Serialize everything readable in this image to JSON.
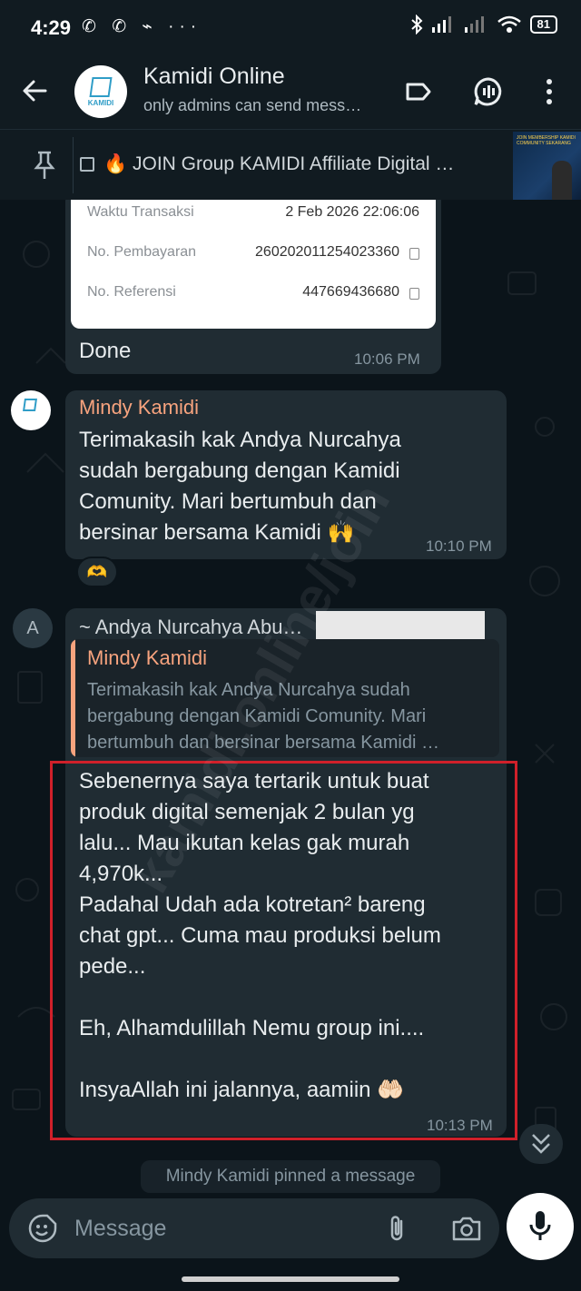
{
  "status_bar": {
    "time": "4:29",
    "left_icons": "✆ ✆ ⌁ ···",
    "battery": "81"
  },
  "header": {
    "title": "Kamidi Online",
    "subtitle": "only admins can send mess…",
    "avatar_text": "KAMIDI"
  },
  "pinned": {
    "text": "🔥 JOIN Group KAMIDI Affiliate Digital …",
    "thumb_text": "JOIN MEMBERSHIP KAMIDI COMMUNITY SEKARANG"
  },
  "receipt": {
    "rows": [
      {
        "label": "Waktu Transaksi",
        "value": "2 Feb 2026 22:06:06"
      },
      {
        "label": "No. Pembayaran",
        "value": "260202011254023360"
      },
      {
        "label": "No. Referensi",
        "value": "447669436680"
      }
    ]
  },
  "messages": [
    {
      "text": "Done",
      "time": "10:06 PM"
    },
    {
      "sender": "Mindy Kamidi",
      "lines": [
        "Terimakasih kak Andya Nurcahya",
        "sudah bergabung dengan Kamidi",
        "Comunity. Mari bertumbuh dan",
        "bersinar bersama Kamidi 🙌"
      ],
      "time": "10:10 PM",
      "reaction": "🫶"
    },
    {
      "avatar_letter": "A",
      "sender": "~ Andya Nurcahya Abu…",
      "quote_sender": "Mindy Kamidi",
      "quote_lines": [
        "Terimakasih kak Andya Nurcahya sudah",
        "bergabung dengan Kamidi Comunity. Mari",
        "bertumbuh dan bersinar bersama Kamidi …"
      ],
      "lines": [
        "Sebenernya saya tertarik untuk buat",
        "produk digital semenjak 2 bulan yg",
        "lalu... Mau ikutan kelas gak murah",
        "4,970k...",
        "Padahal Udah ada kotretan² bareng",
        "chat gpt... Cuma mau produksi belum",
        "pede...",
        "",
        "Eh, Alhamdulillah Nemu group ini....",
        "",
        "InsyaAllah ini jalannya, aamiin 🤲🏻"
      ],
      "time": "10:13 PM"
    }
  ],
  "system_message": "Mindy Kamidi pinned a message",
  "watermark": "kamidi.online/join",
  "composer": {
    "placeholder": "Message"
  }
}
